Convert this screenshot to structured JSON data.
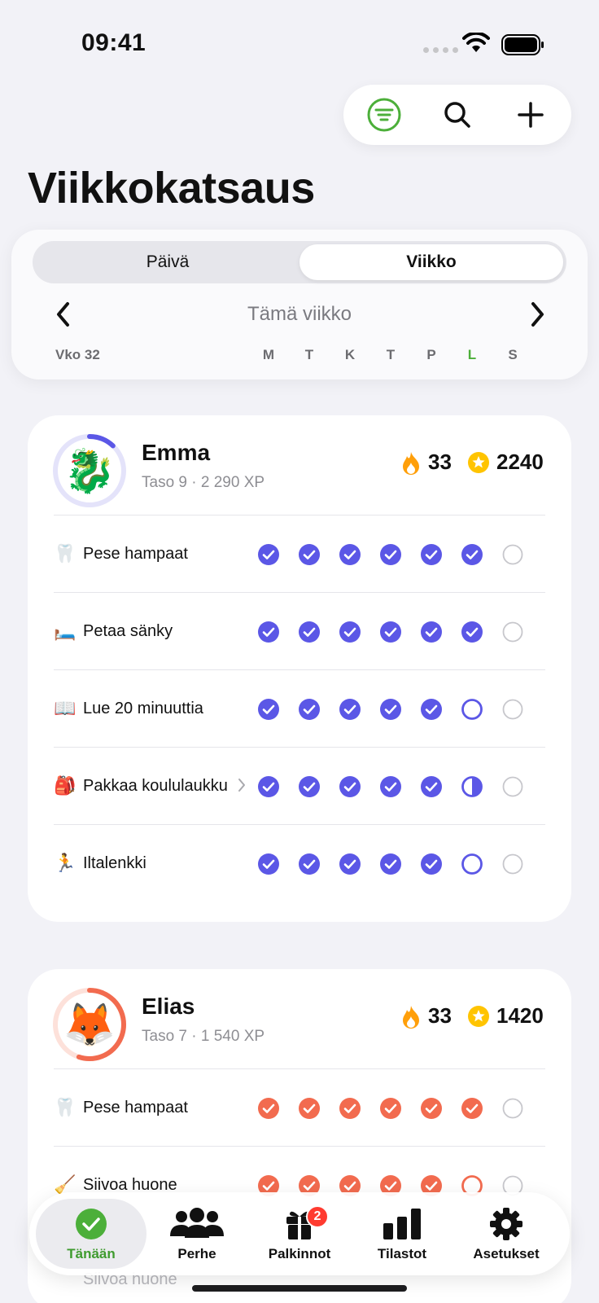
{
  "status_bar": {
    "time": "09:41"
  },
  "title": "Viikkokatsaus",
  "segment": {
    "options": [
      "Päivä",
      "Viikko"
    ],
    "selected": "Viikko"
  },
  "week_nav": {
    "label": "Tämä viikko",
    "week_number": "Vko 32",
    "days": [
      "M",
      "T",
      "K",
      "T",
      "P",
      "L",
      "S"
    ],
    "today_index": 5
  },
  "colors": {
    "accent_green": "#4CAF3A",
    "emma_accent": "#5B57E6",
    "elias_accent": "#F26B4F",
    "streak": "#FF9F0A",
    "coin": "#FFC400"
  },
  "members": [
    {
      "name": "Emma",
      "level_xp": "Taso 9 · 2 290 XP",
      "avatar": "🐉",
      "ring_progress": 0.12,
      "streak": "33",
      "coins": "2240",
      "tasks": [
        {
          "icon": "🦷",
          "label": "Pese hampaat",
          "has_chevron": false,
          "days": [
            "done",
            "done",
            "done",
            "done",
            "done",
            "done",
            "empty"
          ]
        },
        {
          "icon": "🛏️",
          "label": "Petaa sänky",
          "has_chevron": false,
          "days": [
            "done",
            "done",
            "done",
            "done",
            "done",
            "done",
            "empty"
          ]
        },
        {
          "icon": "📖",
          "label": "Lue 20 minuuttia",
          "has_chevron": false,
          "days": [
            "done",
            "done",
            "done",
            "done",
            "done",
            "pending",
            "empty"
          ]
        },
        {
          "icon": "🎒",
          "label": "Pakkaa koululaukku",
          "has_chevron": true,
          "days": [
            "done",
            "done",
            "done",
            "done",
            "done",
            "half",
            "empty"
          ]
        },
        {
          "icon": "🏃",
          "label": "Iltalenkki",
          "has_chevron": false,
          "days": [
            "done",
            "done",
            "done",
            "done",
            "done",
            "pending",
            "empty"
          ]
        }
      ]
    },
    {
      "name": "Elias",
      "level_xp": "Taso 7 · 1 540 XP",
      "avatar": "🦊",
      "ring_progress": 0.55,
      "streak": "33",
      "coins": "1420",
      "tasks": [
        {
          "icon": "🦷",
          "label": "Pese hampaat",
          "has_chevron": false,
          "days": [
            "done",
            "done",
            "done",
            "done",
            "done",
            "done",
            "empty"
          ]
        },
        {
          "icon": "🧹",
          "label": "Siivoa huone",
          "has_chevron": false,
          "days": [
            "done",
            "done",
            "done",
            "done",
            "done",
            "pending",
            "empty"
          ]
        }
      ]
    }
  ],
  "tabbar": {
    "tabs": [
      {
        "label": "Tänään",
        "icon": "check-circle-icon",
        "active": true
      },
      {
        "label": "Perhe",
        "icon": "people-icon",
        "active": false
      },
      {
        "label": "Palkinnot",
        "icon": "gift-icon",
        "active": false,
        "badge": "2"
      },
      {
        "label": "Tilastot",
        "icon": "bar-chart-icon",
        "active": false
      },
      {
        "label": "Asetukset",
        "icon": "gear-icon",
        "active": false
      }
    ]
  }
}
